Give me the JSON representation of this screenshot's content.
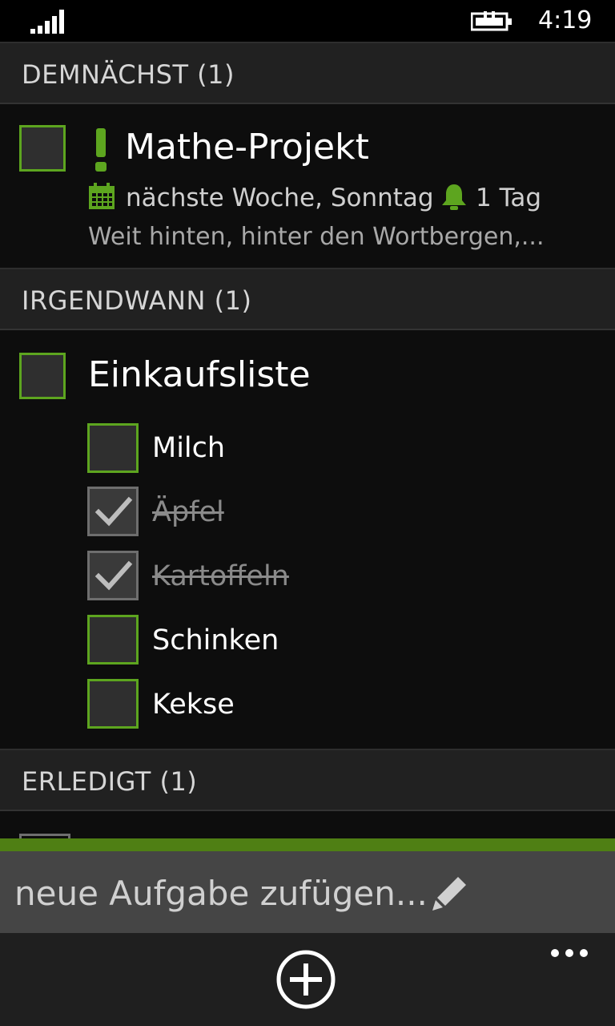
{
  "status_bar": {
    "time": "4:19",
    "signal_icon": "signal-bars-icon",
    "battery_icon": "battery-charging-icon"
  },
  "sections": [
    {
      "title": "DEMNÄCHST (1)"
    },
    {
      "title": "IRGENDWANN (1)"
    },
    {
      "title": "ERLEDIGT (1)"
    }
  ],
  "task_upcoming": {
    "title": "Mathe-Projekt",
    "priority_icon": "exclamation-icon",
    "due": "nächste Woche, Sonntag",
    "reminder": "1 Tag",
    "note": "Weit hinten, hinter den Wortbergen,..."
  },
  "task_someday": {
    "title": "Einkaufsliste",
    "items": [
      {
        "label": "Milch",
        "checked": false
      },
      {
        "label": "Äpfel",
        "checked": true
      },
      {
        "label": "Kartoffeln",
        "checked": true
      },
      {
        "label": "Schinken",
        "checked": false
      },
      {
        "label": "Kekse",
        "checked": false
      }
    ]
  },
  "input": {
    "placeholder": "neue Aufgabe zufügen..."
  },
  "app_bar": {
    "add_icon": "add-circle-icon",
    "more_icon": "more-dots-icon"
  },
  "colors": {
    "accent": "#5da51f",
    "background": "#0d0d0d",
    "header": "#212121"
  }
}
